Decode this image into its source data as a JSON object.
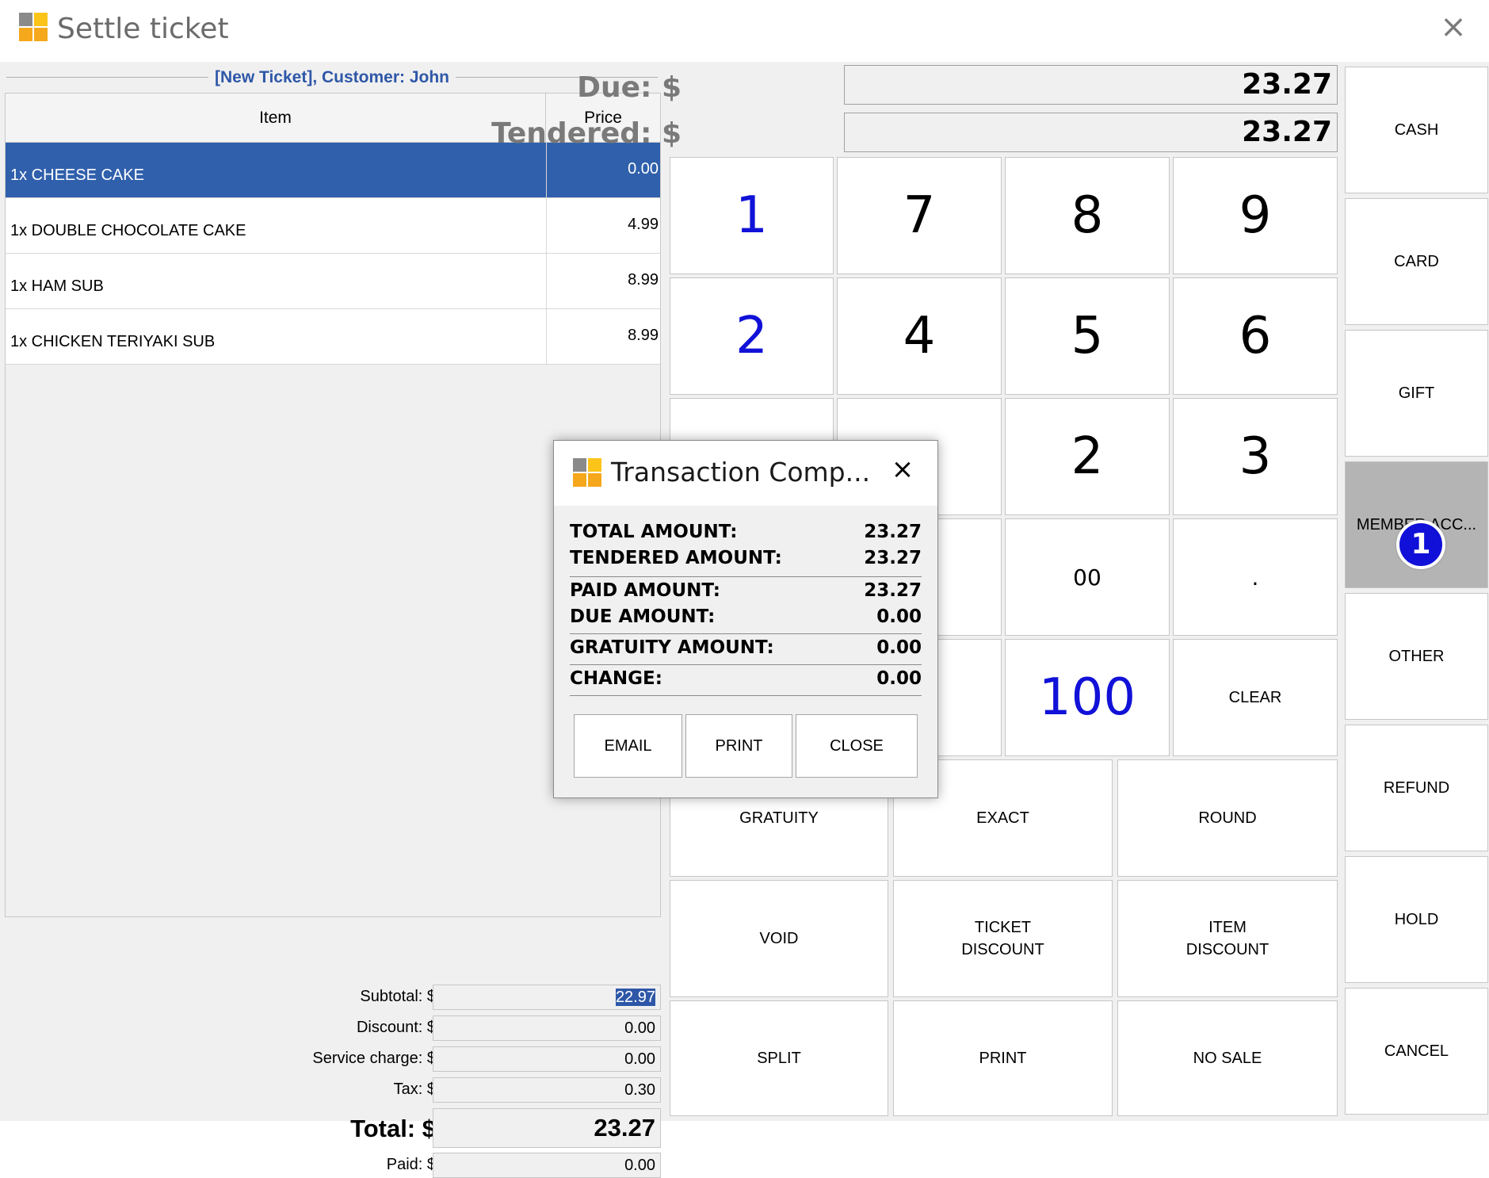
{
  "window": {
    "title": "Settle ticket"
  },
  "ticket": {
    "header": "[New Ticket], Customer: John",
    "columns": {
      "item": "Item",
      "price": "Price"
    },
    "rows": [
      {
        "name": "1x CHEESE CAKE",
        "price": "0.00"
      },
      {
        "name": "1x DOUBLE CHOCOLATE CAKE",
        "price": "4.99"
      },
      {
        "name": "1x HAM SUB",
        "price": "8.99"
      },
      {
        "name": "1x CHICKEN TERIYAKI SUB",
        "price": "8.99"
      }
    ]
  },
  "totals": {
    "subtotal": {
      "label": "Subtotal: $",
      "value": "22.97"
    },
    "discount": {
      "label": "Discount: $",
      "value": "0.00"
    },
    "service": {
      "label": "Service charge: $",
      "value": "0.00"
    },
    "tax": {
      "label": "Tax: $",
      "value": "0.30"
    },
    "total": {
      "label": "Total: $",
      "value": "23.27"
    },
    "paid": {
      "label": "Paid: $",
      "value": "0.00"
    }
  },
  "payment": {
    "due_label": "Due: $",
    "due_value": "23.27",
    "tendered_label": "Tendered: $",
    "tendered_value": "23.27"
  },
  "keypad": {
    "k1": "1",
    "k7": "7",
    "k8": "8",
    "k9": "9",
    "k2b": "2",
    "k4": "4",
    "k5": "5",
    "k6": "6",
    "k2": "2",
    "k3": "3",
    "k00": "00",
    "kdot": ".",
    "k100": "100",
    "clear": "CLEAR",
    "gratuity": "GRATUITY",
    "exact": "EXACT",
    "round": "ROUND",
    "void": "VOID",
    "ticket_discount": "TICKET\nDISCOUNT",
    "item_discount": "ITEM\nDISCOUNT",
    "split": "SPLIT",
    "print": "PRINT",
    "no_sale": "NO SALE"
  },
  "side_buttons": [
    "CASH",
    "CARD",
    "GIFT",
    "MEMBER ACC...",
    "OTHER",
    "REFUND",
    "HOLD",
    "CANCEL"
  ],
  "badge": "1",
  "dialog": {
    "title": "Transaction Comp...",
    "rows": [
      {
        "label": "TOTAL AMOUNT:",
        "value": "23.27"
      },
      {
        "label": "TENDERED AMOUNT:",
        "value": "23.27"
      },
      {
        "label": "PAID AMOUNT:",
        "value": "23.27"
      },
      {
        "label": "DUE AMOUNT:",
        "value": "0.00"
      },
      {
        "label": "GRATUITY AMOUNT:",
        "value": "0.00"
      },
      {
        "label": "CHANGE:",
        "value": "0.00"
      }
    ],
    "buttons": {
      "email": "EMAIL",
      "print": "PRINT",
      "close": "CLOSE"
    }
  },
  "colors": {
    "selection": "#3060ac",
    "header_text": "#2e57a7",
    "keypad_blue": "#1111d8",
    "logo_orange": "#f5a81c",
    "logo_yellow": "#fcc419",
    "logo_gray": "#8a8a8a"
  },
  "icons": {
    "app": "app-logo-icon",
    "close": "close-icon"
  }
}
